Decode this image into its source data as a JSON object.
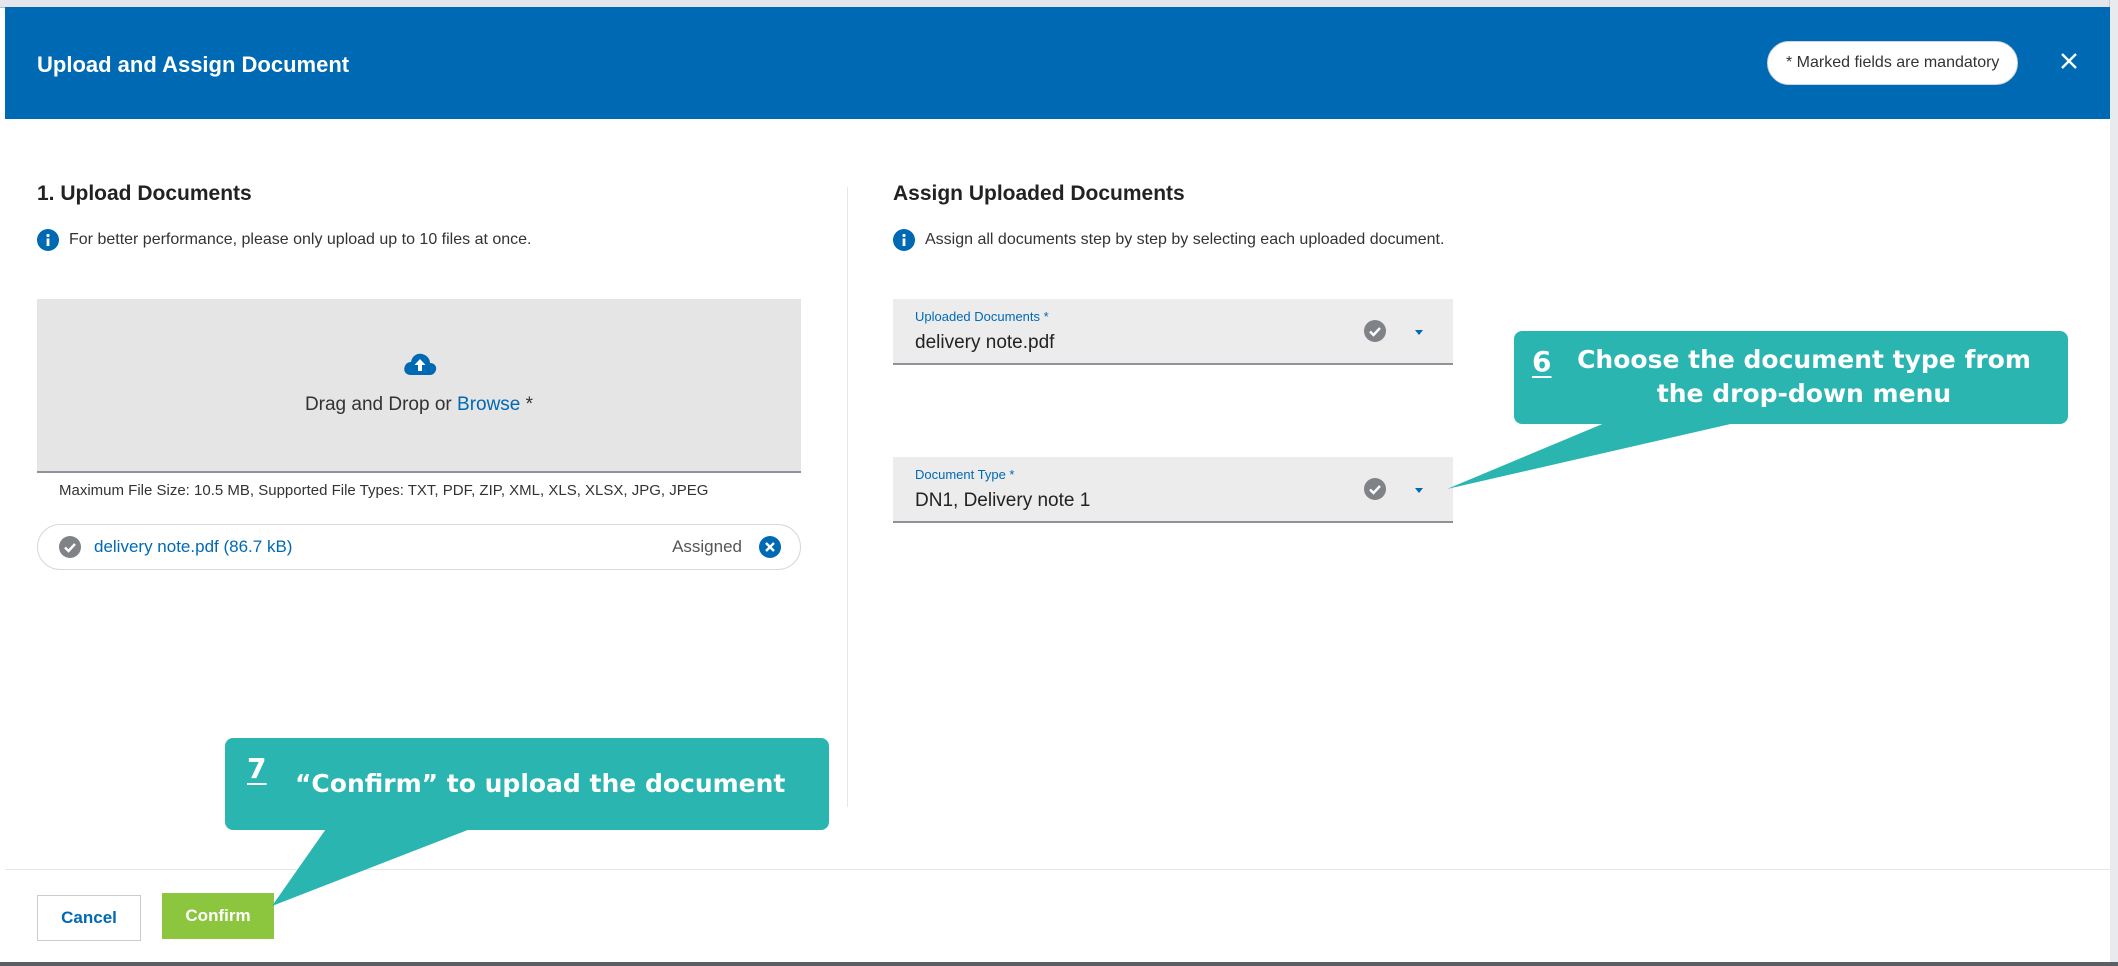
{
  "dialog": {
    "title": "Upload and Assign Document",
    "mandatory_note": "* Marked fields are mandatory",
    "close_icon": "close-icon"
  },
  "upload": {
    "heading": "1. Upload Documents",
    "info": "For better performance, please only upload up to 10 files at once.",
    "drop_prefix": "Drag and Drop or ",
    "browse_label": "Browse",
    "drop_suffix": " *",
    "file_hint": "Maximum File Size: 10.5 MB, Supported File Types: TXT, PDF, ZIP, XML, XLS, XLSX, JPG, JPEG",
    "files": [
      {
        "name": "delivery note.pdf (86.7 kB)",
        "status": "Assigned"
      }
    ]
  },
  "assign": {
    "heading": "Assign Uploaded Documents",
    "info": "Assign all documents step by step by selecting each uploaded document.",
    "uploaded_documents": {
      "label": "Uploaded Documents *",
      "value": "delivery note.pdf"
    },
    "document_type": {
      "label": "Document Type *",
      "value": "DN1, Delivery note 1"
    }
  },
  "footer": {
    "cancel_label": "Cancel",
    "confirm_label": "Confirm"
  },
  "callouts": [
    {
      "number": "6",
      "text": "Choose the document type from the drop-down menu"
    },
    {
      "number": "7",
      "text": "“Confirm” to upload the document"
    }
  ],
  "colors": {
    "header_blue": "#0069b4",
    "confirm_green": "#8cc63f",
    "callout_teal": "#2bb5b1",
    "link_blue": "#0069b4"
  }
}
